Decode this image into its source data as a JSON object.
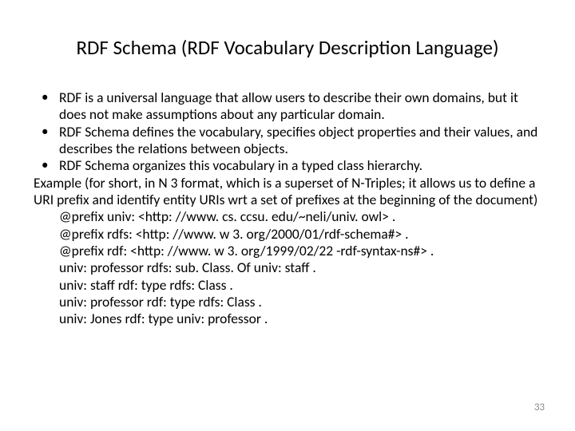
{
  "title": "RDF Schema (RDF Vocabulary Description Language)",
  "bullets": [
    "RDF is a universal language that allow users to describe their own domains, but it does not make assumptions about any particular domain.",
    "RDF Schema defines the vocabulary, specifies object properties and their values, and describes the relations between objects.",
    "RDF Schema organizes this vocabulary in a typed class hierarchy."
  ],
  "example_intro": "Example (for short, in N 3 format, which is a superset of N-Triples; it allows us to define a URI prefix and identify entity URIs wrt a set of prefixes at the beginning of the document)",
  "lines": [
    "@prefix univ: <http: //www. cs. ccsu. edu/~neli/univ. owl> .",
    "@prefix rdfs: <http: //www. w 3. org/2000/01/rdf-schema#> .",
    "@prefix rdf: <http: //www. w 3. org/1999/02/22 -rdf-syntax-ns#> .",
    "univ: professor   rdfs: sub. Class. Of   univ: staff  .",
    "univ: staff   rdf: type  rdfs: Class .",
    "univ: professor rdf: type rdfs: Class .",
    "univ: Jones rdf: type univ: professor ."
  ],
  "page_number": "33"
}
